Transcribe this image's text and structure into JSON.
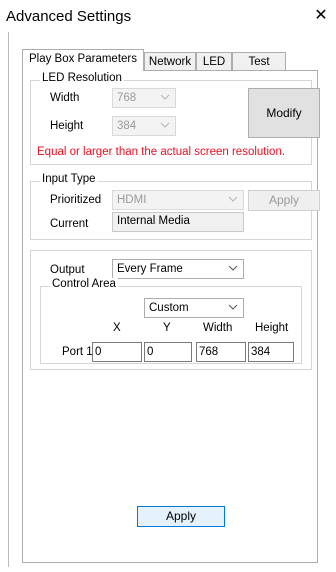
{
  "window": {
    "title": "Advanced Settings",
    "close_glyph": "✕"
  },
  "tabs": [
    {
      "label": "Play Box Parameters",
      "active": true
    },
    {
      "label": "Network",
      "active": false
    },
    {
      "label": "LED",
      "active": false
    },
    {
      "label": "Test",
      "active": false
    }
  ],
  "led_resolution": {
    "legend": "LED Resolution",
    "width_label": "Width",
    "width_value": "768",
    "height_label": "Height",
    "height_value": "384",
    "modify_label": "Modify",
    "warning": "Equal or larger than the actual screen resolution."
  },
  "input_type": {
    "legend": "Input Type",
    "prioritized_label": "Prioritized",
    "prioritized_value": "HDMI",
    "apply_label": "Apply",
    "current_label": "Current",
    "current_value": "Internal Media"
  },
  "output": {
    "output_label": "Output",
    "output_value": "Every Frame",
    "control_area_legend": "Control Area",
    "mode_value": "Custom",
    "columns": [
      "X",
      "Y",
      "Width",
      "Height"
    ],
    "port_label": "Port 1",
    "port_values": [
      "0",
      "0",
      "768",
      "384"
    ]
  },
  "footer": {
    "apply_label": "Apply"
  },
  "colors": {
    "warning": "#e81123",
    "focus_border": "#0078d7"
  }
}
